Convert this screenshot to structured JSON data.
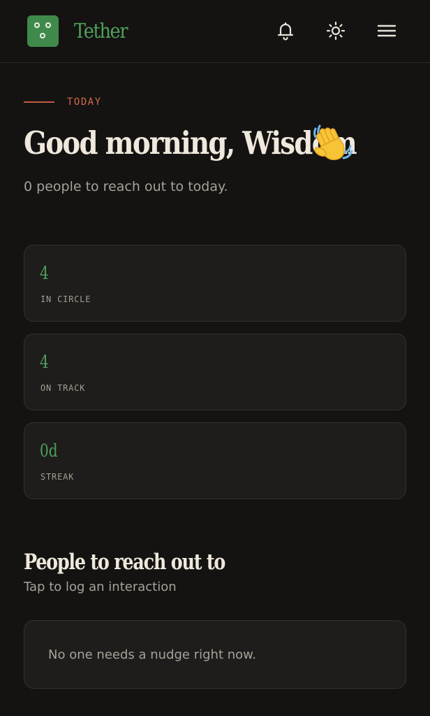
{
  "app": {
    "name": "Tether",
    "accent": "#4fa15a",
    "logo_icon": "face-dots-icon"
  },
  "header": {
    "icons": [
      "bell-icon",
      "sun-icon",
      "menu-icon"
    ]
  },
  "hero": {
    "eyebrow": "TODAY",
    "greeting": "Good morning, Wisdom",
    "greeting_emoji": "waving-hand-icon",
    "subtitle": "0 people to reach out to today."
  },
  "stats": [
    {
      "value": "4",
      "label": "IN CIRCLE"
    },
    {
      "value": "4",
      "label": "ON TRACK"
    },
    {
      "value": "0d",
      "label": "STREAK"
    }
  ],
  "people_section": {
    "title": "People to reach out to",
    "subtitle": "Tap to log an interaction",
    "empty_message": "No one needs a nudge right now."
  }
}
